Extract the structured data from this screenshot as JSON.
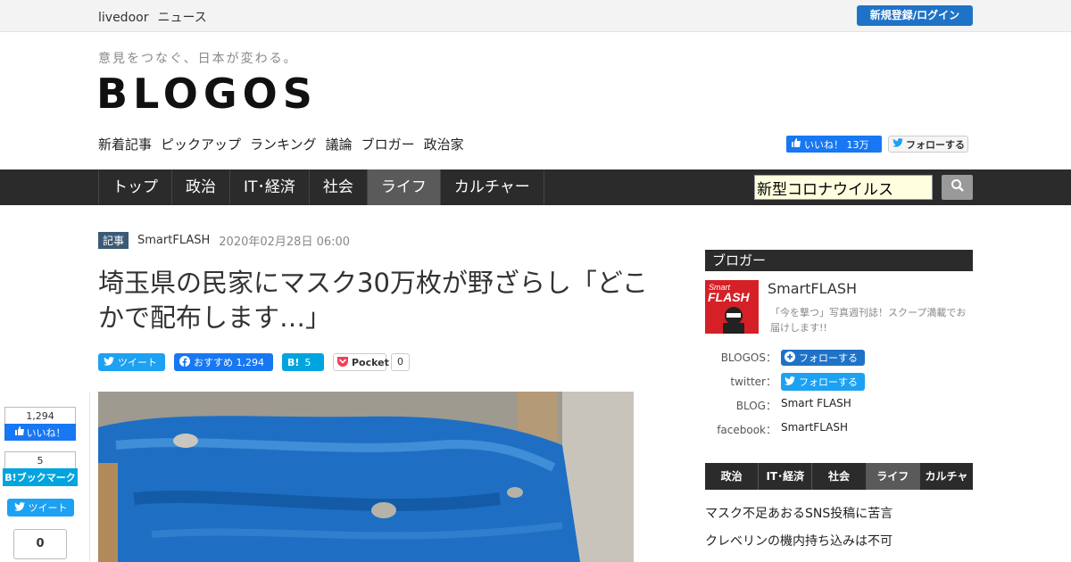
{
  "topbar": {
    "brand_1": "livedoor",
    "brand_2": "ニュース",
    "login_label": "新規登録/ログイン"
  },
  "header": {
    "tagline": "意見をつなぐ、日本が変わる。",
    "logo": "BLOGOS",
    "subnav": [
      "新着記事",
      "ピックアップ",
      "ランキング",
      "議論",
      "ブロガー",
      "政治家"
    ],
    "fb_like_label": "いいね！ 13万",
    "tw_follow_label": "フォローする"
  },
  "mainnav": {
    "tabs": [
      "トップ",
      "政治",
      "IT･経済",
      "社会",
      "ライフ",
      "カルチャー"
    ],
    "active": "ライフ",
    "search_value": "新型コロナウイルス"
  },
  "article": {
    "badge": "記事",
    "author": "SmartFLASH",
    "date": "2020年02月28日 06:00",
    "title": "埼玉県の民家にマスク30万枚が野ざらし「どこかで配布します…」",
    "share": {
      "tweet": "ツイート",
      "fb": "おすすめ 1,294",
      "hatena_icon": "B!",
      "hatena_count": "5",
      "pocket": "Pocket",
      "pocket_count": "0"
    }
  },
  "left_share": {
    "fb_count": "1,294",
    "fb_label": "いいね！",
    "hb_count": "5",
    "hb_label": "B!ブックマーク",
    "tw_label": "ツイート",
    "pocket_count": "0"
  },
  "sidebar": {
    "heading": "ブロガー",
    "avatar_text_1": "Smart",
    "avatar_text_2": "FLASH",
    "name": "SmartFLASH",
    "desc": "「今を撃つ」写真週刊誌！スクープ満載でお届けします!!",
    "blogos_label": "BLOGOS：",
    "blogos_follow": "フォローする",
    "twitter_label": "twitter：",
    "twitter_follow": "フォローする",
    "blog_label": "BLOG：",
    "blog_val": "Smart FLASH",
    "facebook_label": "facebook：",
    "facebook_val": "SmartFLASH",
    "cat_tabs": [
      "政治",
      "IT･経済",
      "社会",
      "ライフ",
      "カルチャー"
    ],
    "cat_active": "ライフ",
    "rankings": [
      "マスク不足あおるSNS投稿に苦言",
      "クレベリンの機内持ち込みは不可"
    ]
  },
  "colors": {
    "nav_bg": "#2b2b2b",
    "active_tab": "#5a5a5a",
    "login_blue": "#1f73c7",
    "twitter": "#1da1f2",
    "facebook": "#1877f2",
    "hatena": "#00a4de"
  }
}
